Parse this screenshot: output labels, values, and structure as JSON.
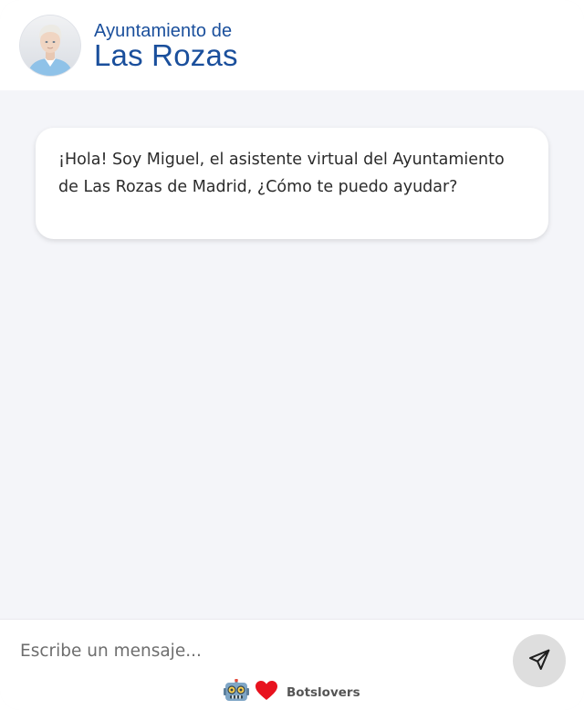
{
  "header": {
    "title_line1": "Ayuntamiento de",
    "title_line2": "Las Rozas",
    "brand_color": "#1a4f9c",
    "avatar_icon": "assistant-avatar"
  },
  "chat": {
    "messages": [
      {
        "sender": "bot",
        "text": "¡Hola! Soy Miguel, el asistente virtual del Ayuntamiento de Las Rozas de Madrid, ¿Cómo te puedo ayudar?"
      }
    ]
  },
  "composer": {
    "placeholder": "Escribe un mensaje...",
    "send_icon": "send-icon"
  },
  "footer": {
    "robot_icon": "robot-icon",
    "heart_icon": "heart-icon",
    "label": "Botslovers"
  }
}
